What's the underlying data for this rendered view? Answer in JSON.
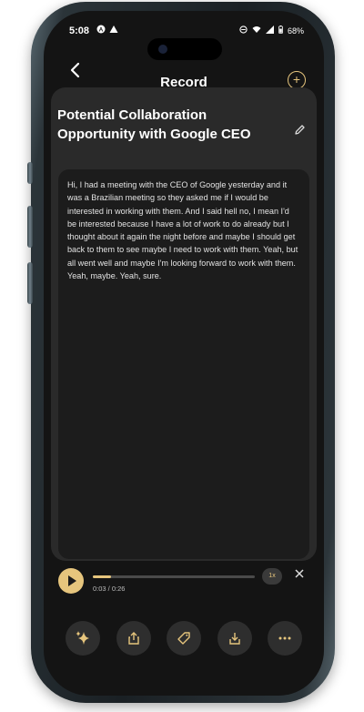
{
  "status_bar": {
    "time": "5:08",
    "battery": "68%"
  },
  "header": {
    "title": "Record"
  },
  "note": {
    "title": "Potential Collaboration Opportunity with Google CEO",
    "transcript": "Hi, I had a meeting with the CEO of Google yesterday and it was a Brazilian meeting so they asked me if I would be interested in working with them. And I said hell no, I mean I'd be interested because I have a lot of work to do already but I thought about it again the night before and maybe I should get back to them to see maybe I need to work with them. Yeah, but all went well and maybe I'm looking forward to work with them. Yeah, maybe. Yeah, sure."
  },
  "player": {
    "time_readout": "0:03 / 0:26",
    "progress_fraction": 0.115,
    "speed_label": "1x"
  },
  "icons": {
    "back": "chevron-left-icon",
    "add": "plus-circle-icon",
    "edit": "pencil-icon",
    "play": "play-icon",
    "close": "close-icon",
    "actions": [
      "sparkles-icon",
      "share-icon",
      "tag-icon",
      "download-icon",
      "more-icon"
    ]
  },
  "colors": {
    "accent": "#e6c57d",
    "card": "#2a2a2a",
    "background": "#141414"
  }
}
